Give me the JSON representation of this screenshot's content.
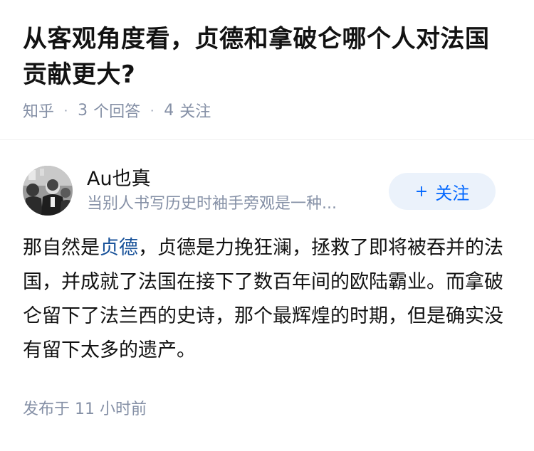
{
  "question": {
    "title": "从客观角度看，贞德和拿破仑哪个人对法国贡献更大?",
    "source": "知乎",
    "answer_count": "3",
    "answer_label": "个回答",
    "follow_count": "4",
    "follow_label": "关注"
  },
  "author": {
    "name": "Au也真",
    "bio": "当别人书写历史时袖手旁观是一种...",
    "follow_button_label": "关注"
  },
  "answer": {
    "text_before": "那自然是",
    "link_text": "贞德",
    "text_after": "，贞德是力挽狂澜，拯救了即将被吞并的法国，并成就了法国在接下了数百年间的欧陆霸业。而拿破仑留下了法兰西的史诗，那个最辉煌的时期，但是确实没有留下太多的遗产。",
    "published": "发布于  11 小时前"
  },
  "colors": {
    "link": "#175199",
    "follow_button_bg": "#ebf2fb",
    "follow_button_text": "#0066ff",
    "meta_text": "#8590a6"
  },
  "icons": [
    "avatar-photo",
    "plus-icon"
  ]
}
